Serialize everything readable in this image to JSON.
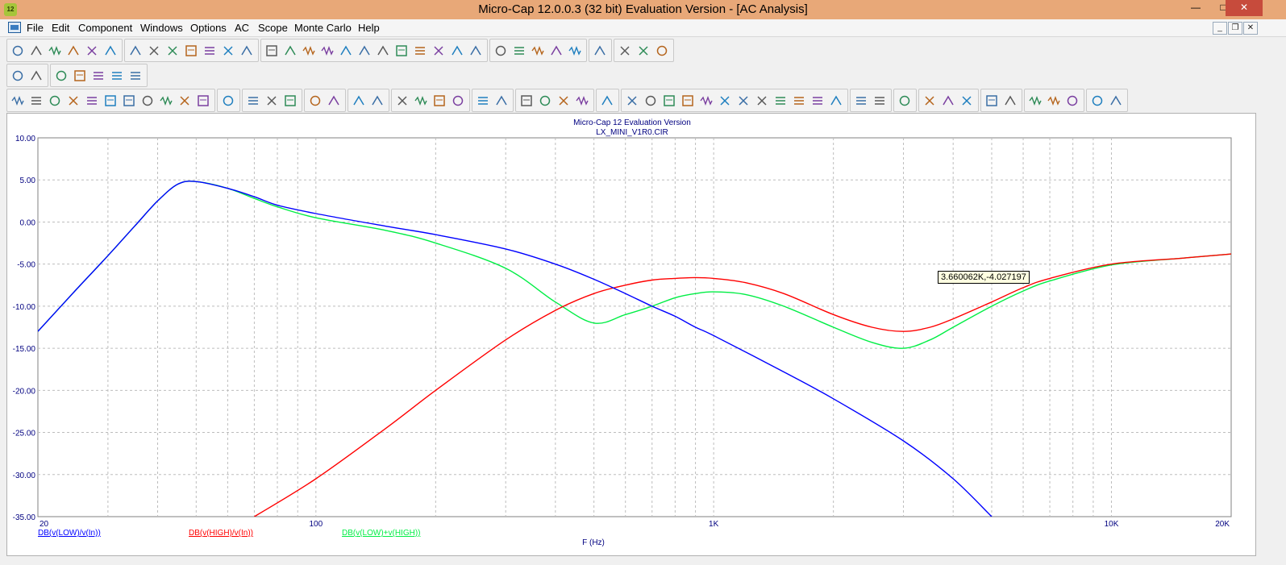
{
  "window": {
    "app_badge": "12",
    "title": "Micro-Cap 12.0.0.3 (32 bit) Evaluation Version - [AC Analysis]",
    "min_glyph": "—",
    "max_glyph": "□",
    "close_glyph": "✕",
    "mdi_min_glyph": "_",
    "mdi_restore_glyph": "❐",
    "mdi_close_glyph": "✕"
  },
  "menu": {
    "items": [
      "File",
      "Edit",
      "Component",
      "Windows",
      "Options",
      "AC",
      "Scope",
      "Monte Carlo",
      "Help"
    ]
  },
  "toolbar1": {
    "groups": [
      [
        "new-file-icon",
        "open-file-icon",
        "save-icon",
        "refresh-icon",
        "print-preview-icon",
        "print-icon"
      ],
      [
        "undo-icon",
        "redo-icon",
        "cut-icon",
        "copy-icon",
        "paste-icon",
        "delete-icon",
        "select-all-icon"
      ],
      [
        "ground-icon",
        "resistor-icon",
        "capacitor-icon",
        "inductor-icon",
        "diode-icon",
        "transistor-icon",
        "fet-icon",
        "opamp-icon",
        "source-icon",
        "battery-icon",
        "probe-icon",
        "node-icon"
      ],
      [
        "cascade-icon",
        "tile-vertical-icon",
        "tile-horizontal-icon",
        "window-icon",
        "window2-icon"
      ],
      [
        "calculator-icon"
      ],
      [
        "book-icon",
        "settings-wizard-icon",
        "globe-icon"
      ]
    ]
  },
  "toolbar2": {
    "groups": [
      [
        "component-mode-icon",
        "text-mode-icon"
      ],
      [
        "limits-icon",
        "properties-icon",
        "tools-icon",
        "plot-icon",
        "plot-edit-icon"
      ]
    ]
  },
  "toolbar3": {
    "groups": [
      [
        "select-arrow-icon",
        "pan-hand-icon",
        "graph-select-icon",
        "dropdown-arrow-icon",
        "scale-icon",
        "zoom-box-icon",
        "scale-x-icon",
        "scale-y-icon",
        "scale-both-icon",
        "fx-icon",
        "text-tool-icon"
      ],
      [
        "tag-icon"
      ],
      [
        "run-icon",
        "stop-icon",
        "pause-icon"
      ],
      [
        "cursor-mode-icon",
        "cursor-mode2-icon"
      ],
      [
        "frame-icon",
        "grid-icon"
      ],
      [
        "col1-icon",
        "col2-icon",
        "col3-icon",
        "col4-icon"
      ],
      [
        "row1-icon",
        "row2-icon"
      ],
      [
        "zoom-x-icon",
        "zoom-y-icon",
        "zoom-fit-icon",
        "zoom-out-icon"
      ],
      [
        "data-points-icon"
      ],
      [
        "cursor-peak-icon",
        "cursor-valley-icon",
        "cursor-high-icon",
        "cursor-low-icon",
        "cursor-inflect-icon",
        "cursor-global-high-icon",
        "cursor-global-low-icon",
        "cursor-top-icon",
        "cursor-bottom-icon",
        "cursor-slope-icon",
        "cursor-next-icon",
        "cursor-prev-icon"
      ],
      [
        "clipboard-icon",
        "dropdown-arrow-icon"
      ],
      [
        "report-icon"
      ],
      [
        "numeric-output-icon",
        "same-x-icon",
        "same-y-icon"
      ],
      [
        "zoom-in-icon",
        "zoom-out2-icon"
      ],
      [
        "tile-icon",
        "dropdown-arrow2-icon",
        "font-icon"
      ],
      [
        "copy-plot-icon",
        "copy-plot2-icon"
      ]
    ]
  },
  "plot": {
    "header_line1": "Micro-Cap 12 Evaluation Version",
    "header_line2": "LX_MINI_V1R0.CIR",
    "tooltip": "3.660062K,-4.027197",
    "colors": {
      "background": "#ffffff",
      "grid": "#bdbdbd",
      "axis_text": "#000080",
      "low": "#0000ff",
      "high": "#ff0000",
      "sum": "#00ee44"
    }
  },
  "chart_data": {
    "type": "line",
    "title": "Micro-Cap 12 Evaluation Version",
    "subtitle": "LX_MINI_V1R0.CIR",
    "xlabel": "F (Hz)",
    "ylabel": "",
    "x_scale": "log",
    "xlim": [
      20,
      20000
    ],
    "ylim": [
      -35,
      10
    ],
    "y_ticks": [
      "10.00",
      "5.00",
      "0.00",
      "-5.00",
      "-10.00",
      "-15.00",
      "-20.00",
      "-25.00",
      "-30.00",
      "-35.00"
    ],
    "x_ticks": [
      {
        "value": 20,
        "label": "20"
      },
      {
        "value": 100,
        "label": "100"
      },
      {
        "value": 1000,
        "label": "1K"
      },
      {
        "value": 10000,
        "label": "10K"
      },
      {
        "value": 20000,
        "label": "20K"
      }
    ],
    "grid": true,
    "legend_position": "bottom",
    "series": [
      {
        "name": "DB(v(LOW)/v(In))",
        "color": "#0000ff",
        "x": [
          20,
          25,
          30,
          35,
          40,
          45,
          50,
          60,
          70,
          80,
          100,
          150,
          200,
          300,
          400,
          500,
          600,
          700,
          800,
          900,
          1000,
          1500,
          2000,
          3000,
          4000,
          5000
        ],
        "y": [
          -13.0,
          -8.0,
          -4.0,
          -0.5,
          2.5,
          4.5,
          4.8,
          4.0,
          3.0,
          2.0,
          1.0,
          -0.5,
          -1.5,
          -3.2,
          -5.0,
          -6.8,
          -8.5,
          -10.0,
          -11.2,
          -12.5,
          -13.5,
          -17.8,
          -21.0,
          -26.0,
          -30.5,
          -35.0
        ]
      },
      {
        "name": "DB(v(HIGH)/v(In))",
        "color": "#ff0000",
        "x": [
          70,
          100,
          150,
          200,
          300,
          400,
          500,
          600,
          700,
          800,
          900,
          1000,
          1200,
          1500,
          2000,
          2500,
          3000,
          3500,
          4000,
          5000,
          6000,
          7000,
          10000,
          15000,
          20000
        ],
        "y": [
          -35.0,
          -30.5,
          -24.5,
          -20.0,
          -14.0,
          -10.5,
          -8.5,
          -7.5,
          -6.9,
          -6.7,
          -6.6,
          -6.7,
          -7.2,
          -8.5,
          -11.0,
          -12.5,
          -13.0,
          -12.5,
          -11.5,
          -9.5,
          -7.8,
          -6.7,
          -5.0,
          -4.3,
          -3.8
        ]
      },
      {
        "name": "DB(v(LOW)+v(HIGH))",
        "color": "#00ee44",
        "x": [
          20,
          25,
          30,
          35,
          40,
          45,
          50,
          60,
          70,
          80,
          100,
          150,
          200,
          300,
          400,
          500,
          600,
          700,
          800,
          900,
          1000,
          1200,
          1500,
          2000,
          2500,
          3000,
          3500,
          4000,
          5000,
          6000,
          7000,
          10000,
          15000,
          20000
        ],
        "y": [
          -13.0,
          -8.0,
          -4.0,
          -0.5,
          2.5,
          4.5,
          4.8,
          4.0,
          2.8,
          1.8,
          0.5,
          -1.0,
          -2.5,
          -5.5,
          -9.5,
          -12.0,
          -11.0,
          -10.0,
          -9.0,
          -8.5,
          -8.3,
          -8.6,
          -10.0,
          -12.5,
          -14.3,
          -15.0,
          -14.0,
          -12.5,
          -10.0,
          -8.2,
          -7.0,
          -5.1,
          -4.3,
          -3.8
        ]
      }
    ]
  }
}
